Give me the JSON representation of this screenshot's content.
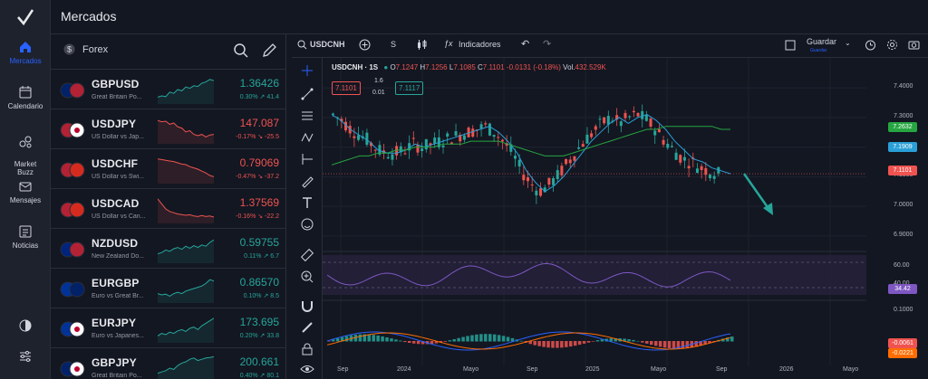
{
  "app": {
    "title": "Mercados"
  },
  "nav": {
    "items": [
      {
        "label": "Mercados",
        "icon": "home-icon",
        "active": true
      },
      {
        "label": "Calendario",
        "icon": "calendar-icon"
      },
      {
        "label": "Market\nBuzz",
        "icon": "buzz-icon"
      },
      {
        "label": "Mensajes",
        "icon": "mail-icon"
      },
      {
        "label": "Noticias",
        "icon": "news-icon"
      }
    ]
  },
  "markets": {
    "category": "Forex",
    "rows": [
      {
        "symbol": "GBPUSD",
        "desc": "Great Britain Po...",
        "price": "1.36426",
        "change": "0.30% ↗ 41.4",
        "dir": "up",
        "flag": "gb-us",
        "spark": [
          0.2,
          0.25,
          0.22,
          0.4,
          0.35,
          0.5,
          0.45,
          0.6,
          0.55,
          0.65,
          0.62,
          0.75,
          0.8,
          0.9,
          0.85
        ]
      },
      {
        "symbol": "USDJPY",
        "desc": "US Dollar vs Jap...",
        "price": "147.087",
        "change": "-0.17% ↘ -25.5",
        "dir": "dn",
        "flag": "us-jp",
        "spark": [
          0.85,
          0.8,
          0.82,
          0.7,
          0.75,
          0.6,
          0.55,
          0.4,
          0.45,
          0.3,
          0.25,
          0.3,
          0.2,
          0.28,
          0.3
        ]
      },
      {
        "symbol": "USDCHF",
        "desc": "US Dollar vs Swi...",
        "price": "0.79069",
        "change": "-0.47% ↘ -37.2",
        "dir": "dn",
        "flag": "us-ch",
        "spark": [
          0.9,
          0.88,
          0.85,
          0.82,
          0.8,
          0.75,
          0.7,
          0.68,
          0.6,
          0.55,
          0.5,
          0.42,
          0.35,
          0.25,
          0.2
        ]
      },
      {
        "symbol": "USDCAD",
        "desc": "US Dollar vs Can...",
        "price": "1.37569",
        "change": "-0.16% ↘ -22.2",
        "dir": "dn",
        "flag": "us-ca",
        "spark": [
          0.9,
          0.7,
          0.5,
          0.4,
          0.35,
          0.3,
          0.28,
          0.25,
          0.27,
          0.22,
          0.2,
          0.24,
          0.2,
          0.22,
          0.18
        ]
      },
      {
        "symbol": "NZDUSD",
        "desc": "New Zealand Do...",
        "price": "0.59755",
        "change": "0.11% ↗ 6.7",
        "dir": "up",
        "flag": "nz-us",
        "spark": [
          0.3,
          0.35,
          0.45,
          0.4,
          0.5,
          0.55,
          0.48,
          0.6,
          0.52,
          0.62,
          0.55,
          0.65,
          0.6,
          0.75,
          0.85
        ]
      },
      {
        "symbol": "EURGBP",
        "desc": "Euro vs Great Br...",
        "price": "0.86570",
        "change": "0.10% ↗ 8.5",
        "dir": "up",
        "flag": "eu-gb",
        "spark": [
          0.3,
          0.25,
          0.28,
          0.2,
          0.3,
          0.35,
          0.3,
          0.4,
          0.45,
          0.5,
          0.55,
          0.6,
          0.7,
          0.85,
          0.8
        ]
      },
      {
        "symbol": "EURJPY",
        "desc": "Euro vs Japanes...",
        "price": "173.695",
        "change": "0.20% ↗ 33.8",
        "dir": "up",
        "flag": "eu-jp",
        "spark": [
          0.2,
          0.3,
          0.25,
          0.35,
          0.3,
          0.4,
          0.45,
          0.38,
          0.5,
          0.55,
          0.45,
          0.6,
          0.7,
          0.8,
          0.9
        ]
      },
      {
        "symbol": "GBPJPY",
        "desc": "Great Britain Po...",
        "price": "200.661",
        "change": "0.40% ↗ 80.1",
        "dir": "up",
        "flag": "gb-jp",
        "spark": [
          0.3,
          0.35,
          0.4,
          0.5,
          0.45,
          0.6,
          0.7,
          0.75,
          0.85,
          0.9,
          0.8,
          0.85,
          0.9,
          0.92,
          0.95
        ]
      }
    ]
  },
  "toolbar": {
    "symbol": "USDCNH",
    "interval": "S",
    "indicators": "Indicadores",
    "save": "Guardar",
    "save_sub": "Guardar"
  },
  "legend": {
    "title": "USDCNH · 1S",
    "o_label": "O",
    "o": "7.1247",
    "h_label": "H",
    "h": "7.1256",
    "l_label": "L",
    "l": "7.1085",
    "c_label": "C",
    "c": "7.1101",
    "chg": "-0.0131 (-0.18%)",
    "vol_label": "Vol.",
    "vol": "432.529K",
    "sell": "7.1101",
    "spread": "1.6",
    "spread2": "0.01",
    "buy": "7.1117"
  },
  "chart_data": {
    "type": "line",
    "title": "USDCNH · 1S",
    "x_labels": [
      "Sep",
      "2024",
      "Mayo",
      "Sep",
      "2025",
      "Mayo",
      "Sep",
      "2026",
      "Mayo"
    ],
    "price_axis": [
      "7.4000",
      "7.3000",
      "7.2000",
      "7.1000",
      "7.0000",
      "6.9000"
    ],
    "ylim": [
      6.86,
      7.44
    ],
    "series": [
      {
        "values": [
          7.31,
          7.29,
          7.26,
          7.24,
          7.22,
          7.19,
          7.18,
          7.18,
          7.19,
          7.21,
          7.2,
          7.21,
          7.22,
          7.23,
          7.24,
          7.25,
          7.26,
          7.27,
          7.25,
          7.22,
          7.18,
          7.12,
          7.08,
          7.05,
          7.07,
          7.1,
          7.14,
          7.18,
          7.22,
          7.25,
          7.28,
          7.3,
          7.28,
          7.3,
          7.31,
          7.29,
          7.26,
          7.22,
          7.19,
          7.16,
          7.15,
          7.13,
          7.12,
          7.11
        ],
        "color": "#2a9fd6"
      },
      {
        "values": [
          7.14,
          7.15,
          7.16,
          7.17,
          7.17,
          7.18,
          7.18,
          7.19,
          7.19,
          7.2,
          7.2,
          7.2,
          7.21,
          7.21,
          7.21,
          7.22,
          7.22,
          7.22,
          7.22,
          7.21,
          7.2,
          7.19,
          7.18,
          7.17,
          7.17,
          7.17,
          7.18,
          7.19,
          7.2,
          7.21,
          7.22,
          7.23,
          7.24,
          7.25,
          7.26,
          7.26,
          7.27,
          7.27,
          7.27,
          7.27,
          7.27,
          7.27,
          7.26,
          7.26
        ],
        "color": "#26a641"
      }
    ],
    "last_values": {
      "ma": "7.2632",
      "ema": "7.1909",
      "price": "7.1101"
    },
    "rsi": {
      "levels": [
        "60.00",
        "40.00"
      ],
      "last": "34.42"
    },
    "macd": {
      "levels": [
        "0.1000"
      ],
      "macd_last": "-0.0061",
      "signal_last": "-0.0221"
    }
  }
}
